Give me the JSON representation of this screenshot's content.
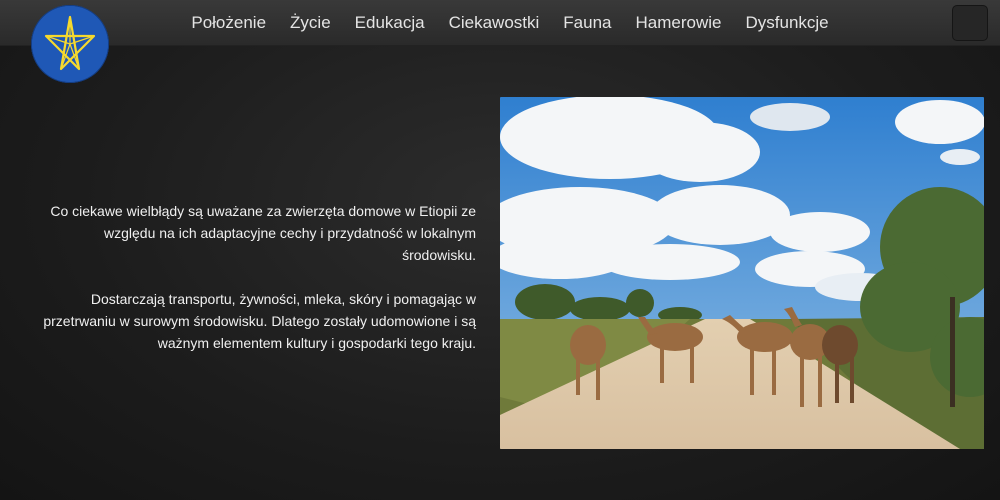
{
  "header": {
    "logo_icon": "ethiopian-emblem-star-icon",
    "nav": [
      "Położenie",
      "Życie",
      "Edukacja",
      "Ciekawostki",
      "Fauna",
      "Hamerowie",
      "Dysfunkcje"
    ],
    "menu_icon": "menu-toggle-icon"
  },
  "main": {
    "paragraph_1": "Co ciekawe wielbłądy są uważane za zwierzęta domowe w Etiopii ze względu na ich adaptacyjne cechy i przydatność w lokalnym środowisku.",
    "paragraph_2": "Dostarczają transportu, żywności, mleka, skóry i pomagając w przetrwaniu w surowym środowisku. Dlatego zostały udomowione i są ważnym elementem kultury i gospodarki tego kraju.",
    "image_icon": "camels-on-road-photo"
  },
  "colors": {
    "logo_blue": "#1f58b6",
    "star_yellow": "#f6d92d",
    "background": "#1c1c1c"
  }
}
